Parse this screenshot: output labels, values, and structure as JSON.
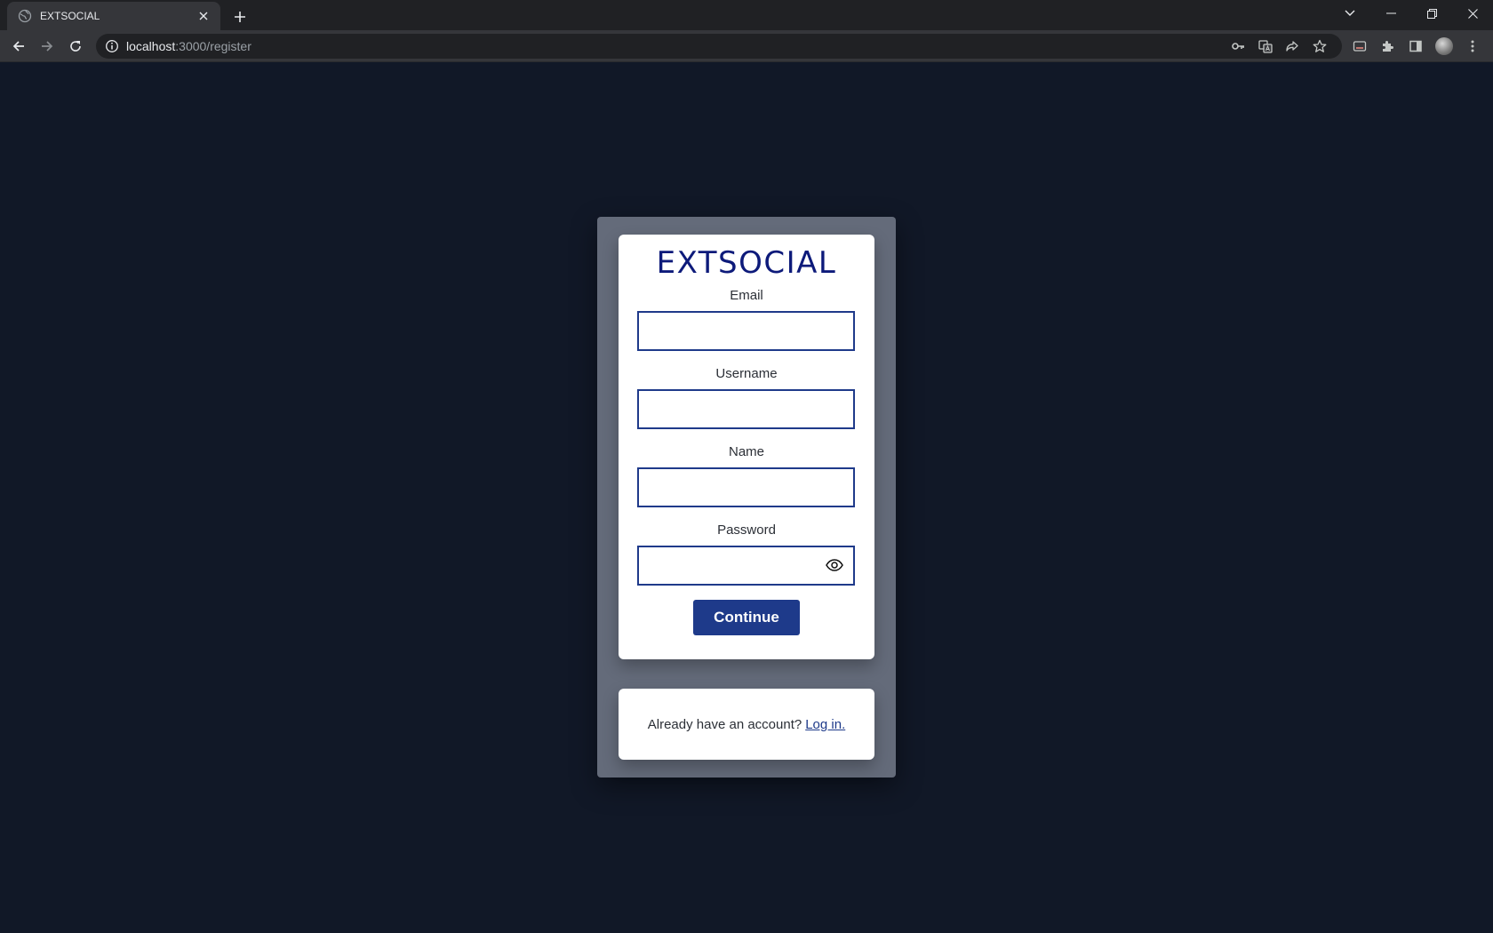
{
  "browser": {
    "tab_title": "EXTSOCIAL",
    "url_host": "localhost",
    "url_path": ":3000/register",
    "icons": [
      "globe-icon",
      "close-icon",
      "new-tab-icon",
      "back-icon",
      "forward-icon",
      "reload-icon",
      "info-icon",
      "key-icon",
      "translate-icon",
      "share-icon",
      "star-icon",
      "cast-icon",
      "extensions-icon",
      "side-panel-icon",
      "profile-avatar",
      "menu-icon",
      "tab-search-icon",
      "minimize-icon",
      "restore-icon",
      "window-close-icon"
    ]
  },
  "page": {
    "background_color": "#111827",
    "accent_color": "#1e3a8a",
    "logo_text": "EXTSOCIAL",
    "fields": {
      "email_label": "Email",
      "username_label": "Username",
      "name_label": "Name",
      "password_label": "Password"
    },
    "values": {
      "email": "",
      "username": "",
      "name": "",
      "password": ""
    },
    "continue_label": "Continue",
    "footer_text": "Already have an account?",
    "login_link": "Log in."
  }
}
